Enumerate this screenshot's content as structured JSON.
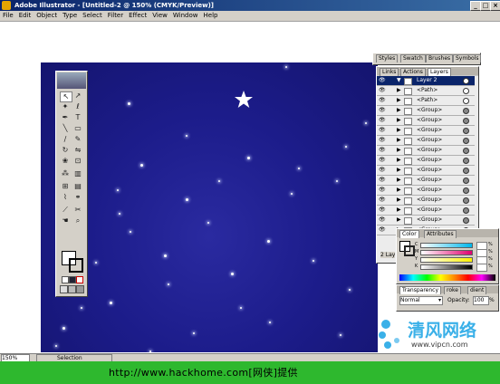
{
  "window": {
    "title": "Adobe Illustrator - [Untitled-2 @ 150% (CMYK/Preview)]",
    "controls": [
      "_",
      "□",
      "×"
    ]
  },
  "menubar": {
    "items": [
      "File",
      "Edit",
      "Object",
      "Type",
      "Select",
      "Filter",
      "Effect",
      "View",
      "Window",
      "Help"
    ]
  },
  "layers_palette": {
    "top_tabs": [
      "Styles",
      "Swatch",
      "Brushes",
      "Symbols"
    ],
    "tabs": [
      "Links",
      "Actions",
      "Layers"
    ],
    "rows": [
      {
        "name": "Layer 2",
        "expanded": true,
        "highlight": true,
        "target": "hollow"
      },
      {
        "name": "<Path>",
        "expanded": false,
        "highlight": false,
        "target": "hollow"
      },
      {
        "name": "<Path>",
        "expanded": false,
        "highlight": false,
        "target": "hollow"
      },
      {
        "name": "<Group>",
        "expanded": false,
        "highlight": false,
        "target": "filled"
      },
      {
        "name": "<Group>",
        "expanded": false,
        "highlight": false,
        "target": "filled"
      },
      {
        "name": "<Group>",
        "expanded": false,
        "highlight": false,
        "target": "filled"
      },
      {
        "name": "<Group>",
        "expanded": false,
        "highlight": false,
        "target": "filled"
      },
      {
        "name": "<Group>",
        "expanded": false,
        "highlight": false,
        "target": "filled"
      },
      {
        "name": "<Group>",
        "expanded": false,
        "highlight": false,
        "target": "filled"
      },
      {
        "name": "<Group>",
        "expanded": false,
        "highlight": false,
        "target": "filled"
      },
      {
        "name": "<Group>",
        "expanded": false,
        "highlight": false,
        "target": "filled"
      },
      {
        "name": "<Group>",
        "expanded": false,
        "highlight": false,
        "target": "filled"
      },
      {
        "name": "<Group>",
        "expanded": false,
        "highlight": false,
        "target": "filled"
      },
      {
        "name": "<Group>",
        "expanded": false,
        "highlight": false,
        "target": "filled"
      },
      {
        "name": "<Group>",
        "expanded": false,
        "highlight": false,
        "target": "filled"
      },
      {
        "name": "<Group>",
        "expanded": false,
        "highlight": false,
        "target": "filled"
      }
    ],
    "footer": "2 Lay"
  },
  "color_palette": {
    "tabs": [
      "Color",
      "Attributes"
    ],
    "channels": [
      {
        "label": "C",
        "color": "#00b7eb",
        "unit": "%"
      },
      {
        "label": "M",
        "color": "#e0006f",
        "unit": "%"
      },
      {
        "label": "Y",
        "color": "#fff200",
        "unit": "%"
      },
      {
        "label": "K",
        "color": "#000000",
        "unit": "%"
      }
    ]
  },
  "transparency_palette": {
    "tabs": [
      "Transparency",
      "roke",
      "dient"
    ],
    "blend_mode": "Normal",
    "opacity_label": "Opacity:",
    "opacity_value": "100",
    "opacity_unit": "%"
  },
  "statusbar": {
    "zoom": "150%",
    "mode": "Selection"
  },
  "artwork": {
    "background_color": "#1c1c8a",
    "star_color": "#ffffff"
  },
  "watermark": {
    "brand": "清风网络",
    "url": "www.vipcn.com",
    "footer_text": "http://www.hackhome.com[网侠]提供",
    "footer_color": "#2eb82e"
  }
}
